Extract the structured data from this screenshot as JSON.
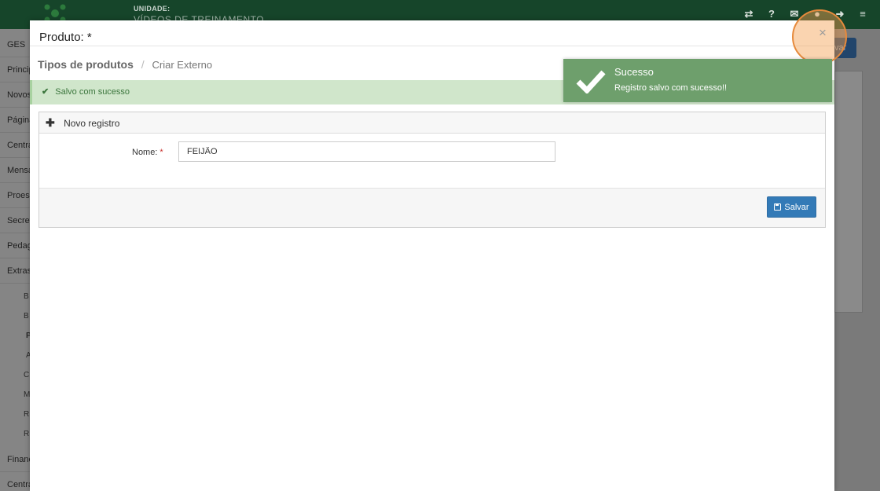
{
  "app": {
    "unit_label": "UNIDADE:",
    "unit_name": "VÍDEOS DE TREINAMENTO",
    "top_icons": [
      "handshake-icon",
      "help-icon",
      "mail-icon",
      "user-icon",
      "logout-icon",
      "menu-icon"
    ],
    "top_icon_glyphs": [
      "⇄",
      "?",
      "✉",
      "●",
      "➜",
      "≡"
    ],
    "user_top": "GES"
  },
  "sidebar": {
    "items": [
      "Principal",
      "Novos",
      "Páginas",
      "Central",
      "Mensagens",
      "Proesc",
      "Secretaria",
      "Pedagógico",
      "Extras"
    ],
    "sub_items": [
      "B",
      "B",
      "P",
      "A",
      "C",
      "M",
      "R",
      "R"
    ],
    "bottom_items": [
      "Financeiro",
      "Central"
    ]
  },
  "background": {
    "right_button_label": "var"
  },
  "modal": {
    "title": "Produto: *",
    "close_label": "×",
    "breadcrumb": {
      "main": "Tipos de produtos",
      "separator": "/",
      "sub": "Criar Externo"
    },
    "alert": {
      "icon": "check-icon",
      "text": "Salvo com sucesso"
    },
    "panel": {
      "header_icon": "plus-icon",
      "header": "Novo registro",
      "field_label": "Nome:",
      "field_required_mark": "*",
      "field_value": "FEIJÃO",
      "save_icon": "floppy-disk-icon",
      "save_label": "Salvar"
    }
  },
  "toast": {
    "title": "Sucesso",
    "message": "Registro salvo com sucesso!!",
    "background_color": "#6e9f6c"
  },
  "colors": {
    "topbar": "#16452a",
    "primary_button": "#337ab7",
    "success_alert_bg": "#d0e6cb",
    "success_text": "#3b763d"
  }
}
